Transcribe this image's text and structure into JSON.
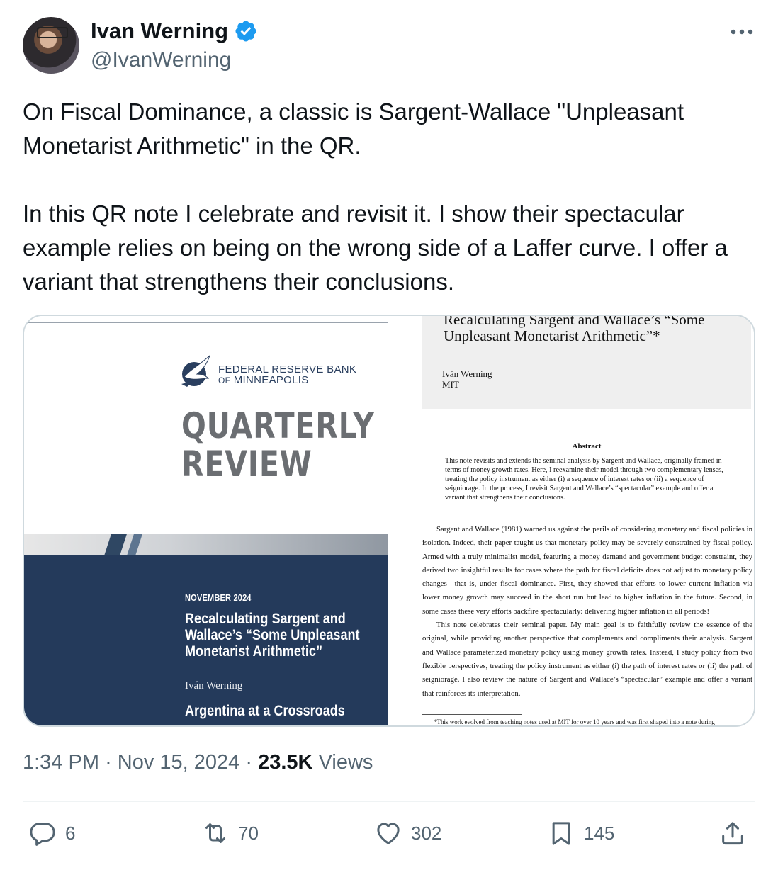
{
  "author": {
    "name": "Ivan Werning",
    "handle": "@IvanWerning",
    "verified": true,
    "verified_color": "#1d9bf0"
  },
  "tweet": {
    "paragraphs": [
      "On Fiscal Dominance, a classic is Sargent-Wallace \"Unpleasant Monetarist Arithmetic\" in the QR.",
      "In this QR note I celebrate and revisit it. I show their spectacular example relies on being on the wrong side of a Laffer curve. I offer a variant that strengthens their conclusions."
    ]
  },
  "media": {
    "cover": {
      "bank_line1": "FEDERAL RESERVE BANK",
      "bank_of": "OF",
      "bank_line2": "MINNEAPOLIS",
      "review_line1": "QUARTERLY",
      "review_line2": "REVIEW",
      "date": "NOVEMBER 2024",
      "article_title": "Recalculating Sargent and Wallace’s “Some Unpleasant Monetarist Arithmetic”",
      "article_author": "Iván Werning",
      "next_article": "Argentina at a Crossroads",
      "accent_color": "#243a5b"
    },
    "paper": {
      "title": "Recalculating Sargent and Wallace’s “Some Unpleasant Monetarist Arithmetic”*",
      "author_name": "Iván Werning",
      "author_affiliation": "MIT",
      "abstract_heading": "Abstract",
      "abstract": "This note revisits and extends the seminal analysis by Sargent and Wallace, originally framed in terms of money growth rates. Here, I reexamine their model through two complementary lenses, treating the policy instrument as either (i) a sequence of interest rates or (ii) a sequence of seigniorage. In the process, I revisit Sargent and Wallace’s “spectacular” example and offer a variant that strengthens their conclusions.",
      "body_p1": "Sargent and Wallace (1981) warned us against the perils of considering monetary and fiscal policies in isolation. Indeed, their paper taught us that monetary policy may be severely constrained by fiscal policy. Armed with a truly minimalist model, featuring a money demand and government budget constraint, they derived two insightful results for cases where the path for fiscal deficits does not adjust to monetary policy changes—that is, under fiscal dominance. First, they showed that efforts to lower current inflation via lower money growth may succeed in the short run but lead to higher inflation in the future. Second, in some cases these very efforts backfire spectacularly: delivering higher inflation in all periods!",
      "body_p2": "This note celebrates their seminal paper. My main goal is to faithfully review the essence of the original, while providing another perspective that complements and compliments their analysis. Sargent and Wallace parameterized monetary policy using money growth rates. Instead, I study policy from two flexible perspectives, treating the policy instrument as either (i) the path of interest rates or (ii) the path of seigniorage. I also review the nature of Sargent and Wallace’s “spectacular” example and offer a variant that reinforces its interpretation.",
      "footnote": "*This work evolved from teaching notes used at MIT for over 10 years and was first shaped into a note during"
    }
  },
  "meta": {
    "time": "1:34 PM",
    "sep": "·",
    "date": "Nov 15, 2024",
    "views_count": "23.5K",
    "views_label": "Views"
  },
  "actions": {
    "replies": "6",
    "reposts": "70",
    "likes": "302",
    "bookmarks": "145"
  }
}
